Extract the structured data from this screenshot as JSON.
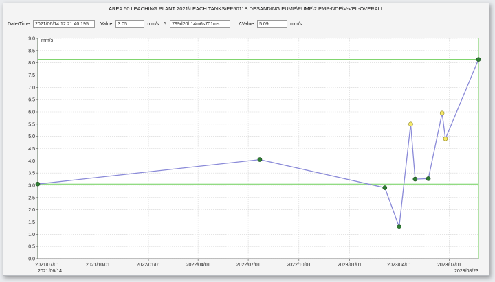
{
  "window": {
    "title": "AREA 50 LEACHING PLANT 2021\\LEACH TANKS\\PP5011B DESANDING PUMP\\PUMP\\2 PMP-NDE\\V-VEL-OVERALL"
  },
  "readout": {
    "datetime_label": "Date/Time:",
    "datetime_value": "2021/06/14 12:21:40.195",
    "value_label": "Value:",
    "value_value": "3.05",
    "value_unit": "mm/s",
    "delta_label": "Δ:",
    "delta_value": "799d20h14m6s701ms",
    "dvalue_label": "ΔValue:",
    "dvalue_value": "5.09",
    "dvalue_unit": "mm/s"
  },
  "colors": {
    "line": "#8a8ad8",
    "normal_point": "#2e7d32",
    "alert_point": "#f5ea6a",
    "cursor_line": "#6fcf5a",
    "grid": "#d4d4d4"
  },
  "chart_data": {
    "type": "line",
    "ylabel": "mm/s",
    "ylim": [
      0,
      9
    ],
    "yticks": [
      "0.0",
      "0.5",
      "1.0",
      "1.5",
      "2.0",
      "2.5",
      "3.0",
      "3.5",
      "4.0",
      "4.5",
      "5.0",
      "5.5",
      "6.0",
      "6.5",
      "7.0",
      "7.5",
      "8.0",
      "8.5",
      "9.0"
    ],
    "xlim": [
      "2021-06-14",
      "2023-08-23"
    ],
    "xticks": [
      {
        "date": "2021-07-01",
        "label": "2021/07/01"
      },
      {
        "date": "2021-10-01",
        "label": "2021/10/01"
      },
      {
        "date": "2022-01-01",
        "label": "2022/01/01"
      },
      {
        "date": "2022-04-01",
        "label": "2022/04/01"
      },
      {
        "date": "2022-07-01",
        "label": "2022/07/01"
      },
      {
        "date": "2022-10-01",
        "label": "2022/10/01"
      },
      {
        "date": "2023-01-01",
        "label": "2023/01/01"
      },
      {
        "date": "2023-04-01",
        "label": "2023/04/01"
      },
      {
        "date": "2023-07-01",
        "label": "2023/07/01"
      }
    ],
    "range_labels": {
      "start": "2021/06/14",
      "end": "2023/08/23"
    },
    "grid": true,
    "cursor_lines": [
      3.05,
      8.14
    ],
    "series": [
      {
        "points": [
          {
            "x": "2021-06-14",
            "y": 3.05,
            "status": "normal"
          },
          {
            "x": "2022-07-22",
            "y": 4.05,
            "status": "normal"
          },
          {
            "x": "2023-03-06",
            "y": 2.9,
            "status": "normal"
          },
          {
            "x": "2023-04-01",
            "y": 1.3,
            "status": "normal"
          },
          {
            "x": "2023-04-22",
            "y": 5.5,
            "status": "alert"
          },
          {
            "x": "2023-04-30",
            "y": 3.25,
            "status": "normal"
          },
          {
            "x": "2023-05-24",
            "y": 3.27,
            "status": "normal"
          },
          {
            "x": "2023-06-18",
            "y": 5.95,
            "status": "alert"
          },
          {
            "x": "2023-06-24",
            "y": 4.9,
            "status": "alert"
          },
          {
            "x": "2023-08-23",
            "y": 8.14,
            "status": "normal"
          }
        ]
      }
    ]
  }
}
